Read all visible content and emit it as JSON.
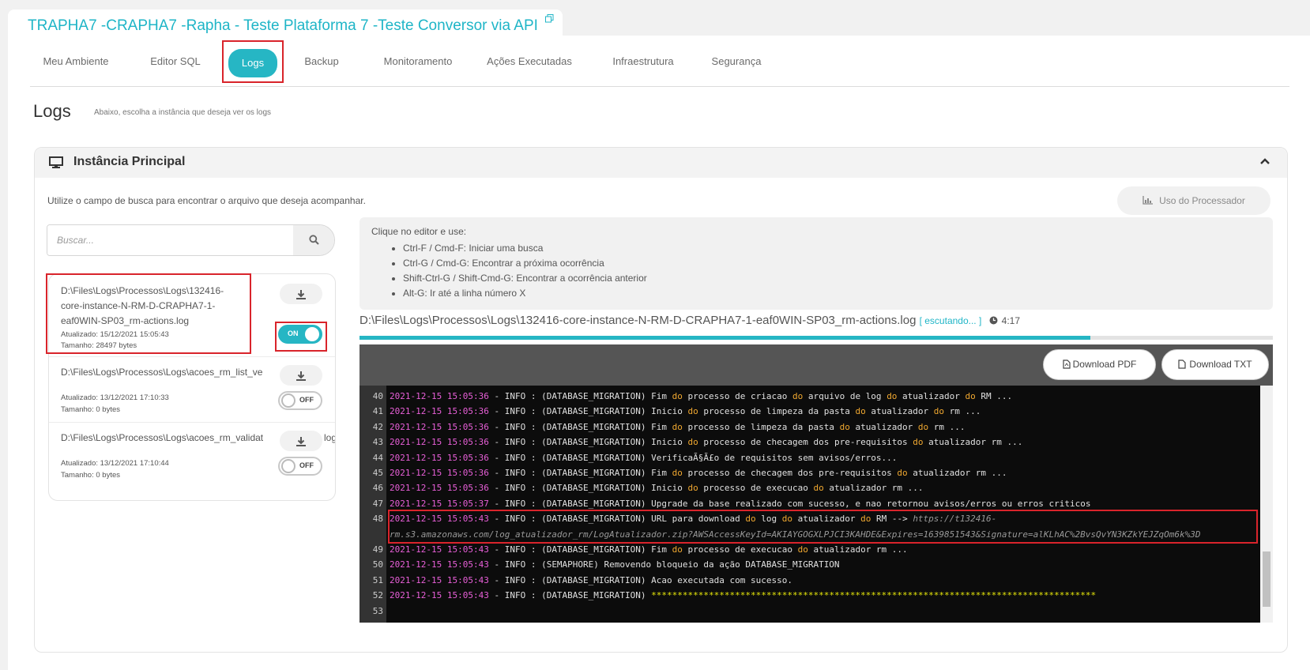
{
  "header": {
    "title": "TRAPHA7 -CRAPHA7 -Rapha - Teste Plataforma 7 -Teste Conversor via API"
  },
  "nav": {
    "tabs": [
      {
        "label": "Meu Ambiente"
      },
      {
        "label": "Editor SQL"
      },
      {
        "label": "Logs"
      },
      {
        "label": "Backup"
      },
      {
        "label": "Monitoramento"
      },
      {
        "label": "Ações Executadas"
      },
      {
        "label": "Infraestrutura"
      },
      {
        "label": "Segurança"
      }
    ]
  },
  "page": {
    "title": "Logs",
    "subtitle": "Abaixo, escolha a instância que deseja ver os logs"
  },
  "panel": {
    "title": "Instância Principal",
    "hint": "Utilize o campo de busca para encontrar o arquivo que deseja acompanhar.",
    "cpu_button": "Uso do Processador"
  },
  "search": {
    "placeholder": "Buscar..."
  },
  "files": [
    {
      "path_lines": [
        "D:\\Files\\Logs\\Processos\\Logs\\132416-",
        "core-instance-N-RM-D-CRAPHA7-1-",
        "eaf0WIN-SP03_rm-actions.log"
      ],
      "updated": "Atualizado: 15/12/2021 15:05:43",
      "size": "Tamanho: 28497 bytes",
      "toggle": "ON"
    },
    {
      "path_lines": [
        "D:\\Files\\Logs\\Processos\\Logs\\acoes_rm_list_ve"
      ],
      "updated": "Atualizado: 13/12/2021 17:10:33",
      "size": "Tamanho: 0 bytes",
      "toggle": "OFF"
    },
    {
      "path_lines": [
        "D:\\Files\\Logs\\Processos\\Logs\\acoes_rm_validat",
        "log"
      ],
      "updated": "Atualizado: 13/12/2021 17:10:44",
      "size": "Tamanho: 0 bytes",
      "toggle": "OFF"
    }
  ],
  "help": {
    "intro": "Clique no editor e use:",
    "items": [
      "Ctrl-F / Cmd-F: Iniciar uma busca",
      "Ctrl-G / Cmd-G: Encontrar a próxima ocorrência",
      "Shift-Ctrl-G / Shift-Cmd-G: Encontrar a ocorrência anterior",
      "Alt-G: Ir até a linha número X"
    ]
  },
  "log": {
    "path": "D:\\Files\\Logs\\Processos\\Logs\\132416-core-instance-N-RM-D-CRAPHA7-1-eaf0WIN-SP03_rm-actions.log",
    "status": "[ escutando... ]",
    "time": "4:17",
    "progress": 0.8,
    "download_pdf": "Download PDF",
    "download_txt": "Download TXT"
  },
  "editor": {
    "lines": [
      {
        "n": "40",
        "ts": "2021-12-15 15:05:36",
        "parts": [
          [
            " - INFO : (DATABASE_MIGRATION) Fim ",
            ""
          ],
          [
            "do",
            "kw"
          ],
          [
            " processo de criacao ",
            ""
          ],
          [
            "do",
            "kw"
          ],
          [
            " arquivo de log ",
            ""
          ],
          [
            "do",
            "kw"
          ],
          [
            " atualizador ",
            ""
          ],
          [
            "do",
            "kw"
          ],
          [
            " RM ...",
            ""
          ]
        ]
      },
      {
        "n": "41",
        "ts": "2021-12-15 15:05:36",
        "parts": [
          [
            " - INFO : (DATABASE_MIGRATION) Inicio ",
            ""
          ],
          [
            "do",
            "kw"
          ],
          [
            " processo de limpeza da pasta ",
            ""
          ],
          [
            "do",
            "kw"
          ],
          [
            " atualizador ",
            ""
          ],
          [
            "do",
            "kw"
          ],
          [
            " rm ...",
            ""
          ]
        ]
      },
      {
        "n": "42",
        "ts": "2021-12-15 15:05:36",
        "parts": [
          [
            " - INFO : (DATABASE_MIGRATION) Fim ",
            ""
          ],
          [
            "do",
            "kw"
          ],
          [
            " processo de limpeza da pasta ",
            ""
          ],
          [
            "do",
            "kw"
          ],
          [
            " atualizador ",
            ""
          ],
          [
            "do",
            "kw"
          ],
          [
            " rm ...",
            ""
          ]
        ]
      },
      {
        "n": "43",
        "ts": "2021-12-15 15:05:36",
        "parts": [
          [
            " - INFO : (DATABASE_MIGRATION) Inicio ",
            ""
          ],
          [
            "do",
            "kw"
          ],
          [
            " processo de checagem dos pre-requisitos ",
            ""
          ],
          [
            "do",
            "kw"
          ],
          [
            " atualizador rm ...",
            ""
          ]
        ]
      },
      {
        "n": "44",
        "ts": "2021-12-15 15:05:36",
        "parts": [
          [
            " - INFO : (DATABASE_MIGRATION) VerificaÃ§Ã£o de requisitos sem avisos/erros...",
            ""
          ]
        ]
      },
      {
        "n": "45",
        "ts": "2021-12-15 15:05:36",
        "parts": [
          [
            " - INFO : (DATABASE_MIGRATION) Fim ",
            ""
          ],
          [
            "do",
            "kw"
          ],
          [
            " processo de checagem dos pre-requisitos ",
            ""
          ],
          [
            "do",
            "kw"
          ],
          [
            " atualizador rm ...",
            ""
          ]
        ]
      },
      {
        "n": "46",
        "ts": "2021-12-15 15:05:36",
        "parts": [
          [
            " - INFO : (DATABASE_MIGRATION) Inicio ",
            ""
          ],
          [
            "do",
            "kw"
          ],
          [
            " processo de execucao ",
            ""
          ],
          [
            "do",
            "kw"
          ],
          [
            " atualizador rm ...",
            ""
          ]
        ]
      },
      {
        "n": "47",
        "ts": "2021-12-15 15:05:37",
        "parts": [
          [
            " - INFO : (DATABASE_MIGRATION) Upgrade da base realizado com sucesso, e nao retornou avisos/erros ou erros criticos",
            ""
          ]
        ]
      },
      {
        "n": "48",
        "ts": "2021-12-15 15:05:43",
        "parts": [
          [
            " - INFO : (DATABASE_MIGRATION) URL para download ",
            ""
          ],
          [
            "do",
            "kw"
          ],
          [
            " log ",
            ""
          ],
          [
            "do",
            "kw"
          ],
          [
            " atualizador ",
            ""
          ],
          [
            "do",
            "kw"
          ],
          [
            " RM --> ",
            ""
          ],
          [
            "https://t132416-",
            "url"
          ]
        ]
      },
      {
        "n": "",
        "ts": "",
        "parts": [
          [
            "rm.s3.amazonaws.com/log_atualizador_rm/LogAtualizador.zip?AWSAccessKeyId=AKIAYGOGXLPJCI3KAHDE&Expires=1639851543&Signature=alKLhAC%2BvsQvYN3KZkYEJZqOm6k%3D",
            "url"
          ]
        ]
      },
      {
        "n": "49",
        "ts": "2021-12-15 15:05:43",
        "parts": [
          [
            " - INFO : (DATABASE_MIGRATION) Fim ",
            ""
          ],
          [
            "do",
            "kw"
          ],
          [
            " processo de execucao ",
            ""
          ],
          [
            "do",
            "kw"
          ],
          [
            " atualizador rm ...",
            ""
          ]
        ]
      },
      {
        "n": "50",
        "ts": "2021-12-15 15:05:43",
        "parts": [
          [
            " - INFO : (SEMAPHORE) Removendo bloqueio da ação DATABASE_MIGRATION",
            ""
          ]
        ]
      },
      {
        "n": "51",
        "ts": "2021-12-15 15:05:43",
        "parts": [
          [
            " - INFO : (DATABASE_MIGRATION) Acao executada com sucesso.",
            ""
          ]
        ]
      },
      {
        "n": "52",
        "ts": "2021-12-15 15:05:43",
        "parts": [
          [
            " - INFO : (DATABASE_MIGRATION) ",
            ""
          ],
          [
            "*************************************************************************************",
            "stars"
          ]
        ]
      },
      {
        "n": "53",
        "ts": "",
        "parts": []
      }
    ]
  },
  "colors": {
    "accent": "#26b6c4",
    "title": "#1fb5c7",
    "highlight": "#d9242b",
    "timestamp": "#e85fd8",
    "keyword": "#f0a830"
  }
}
